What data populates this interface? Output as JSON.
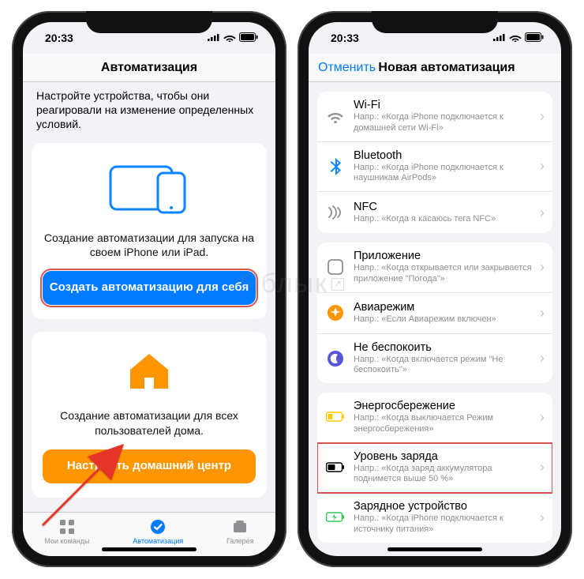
{
  "status": {
    "time": "20:33"
  },
  "left": {
    "nav_title": "Автоматизация",
    "intro": "Настройте устройства, чтобы они реагировали на изменение определенных условий.",
    "card1_text": "Создание автоматизации для запуска на своем iPhone или iPad.",
    "card1_btn": "Создать автоматизацию для себя",
    "card2_text": "Создание автоматизации для всех пользователей дома.",
    "card2_btn": "Настроить домашний центр",
    "tabs": {
      "my": "Мои команды",
      "auto": "Автоматизация",
      "gallery": "Галерея"
    }
  },
  "right": {
    "cancel": "Отменить",
    "nav_title": "Новая автоматизация",
    "rows": {
      "wifi": {
        "title": "Wi-Fi",
        "sub": "Напр.: «Когда iPhone подключается к домашней сети Wi-Fi»"
      },
      "bt": {
        "title": "Bluetooth",
        "sub": "Напр.: «Когда iPhone подключается к наушникам AirPods»"
      },
      "nfc": {
        "title": "NFC",
        "sub": "Напр.: «Когда я касаюсь тега NFC»"
      },
      "app": {
        "title": "Приложение",
        "sub": "Напр.: «Когда открывается или закрывается приложение \"Погода\"»"
      },
      "air": {
        "title": "Авиарежим",
        "sub": "Напр.: «Если Авиарежим включен»"
      },
      "dnd": {
        "title": "Не беспокоить",
        "sub": "Напр.: «Когда включается режим \"Не беспокоить\"»"
      },
      "lpm": {
        "title": "Энергосбережение",
        "sub": "Напр.: «Когда выключается Режим энергосбережения»"
      },
      "batt": {
        "title": "Уровень заряда",
        "sub": "Напр.: «Когда заряд аккумулятора поднимется выше 50 %»"
      },
      "charge": {
        "title": "Зарядное устройство",
        "sub": "Напр.: «Когда iPhone подключается к источнику питания»"
      }
    }
  },
  "watermark": "Яблык"
}
